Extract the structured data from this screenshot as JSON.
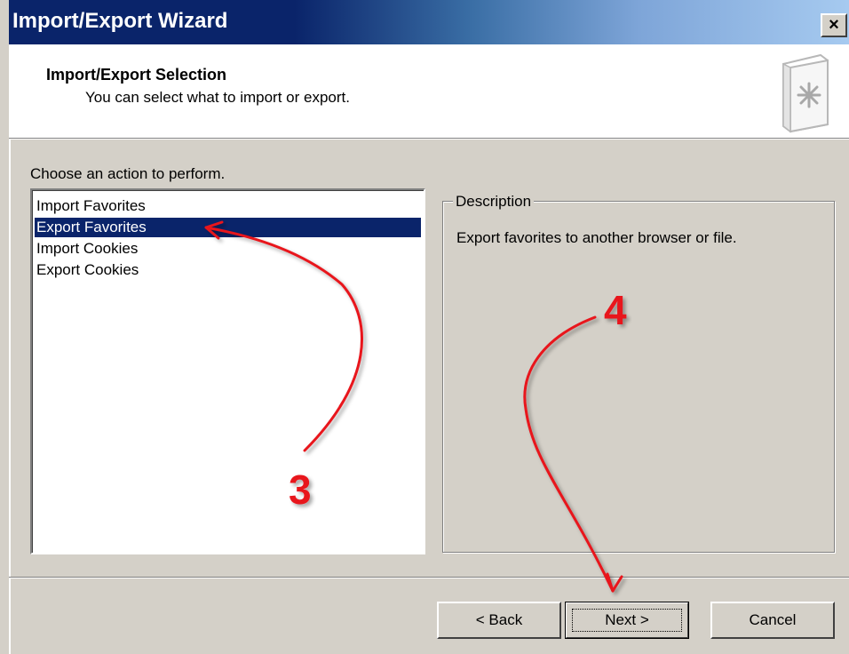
{
  "window": {
    "title": "Import/Export Wizard",
    "close_glyph": "×",
    "close_icon": "close-icon"
  },
  "header": {
    "title": "Import/Export Selection",
    "subtitle": "You can select what to import or export.",
    "icon": "wizard-book-icon"
  },
  "main": {
    "choose_label": "Choose an action to perform.",
    "actions": [
      {
        "label": "Import Favorites",
        "selected": false
      },
      {
        "label": "Export Favorites",
        "selected": true
      },
      {
        "label": "Import Cookies",
        "selected": false
      },
      {
        "label": "Export Cookies",
        "selected": false
      }
    ],
    "description_legend": "Description",
    "description_text": "Export favorites to another browser or file."
  },
  "buttons": {
    "back": "< Back",
    "next": "Next >",
    "cancel": "Cancel"
  },
  "annotations": {
    "step3": "3",
    "step4": "4",
    "color": "#e8121a"
  },
  "colors": {
    "title_active": "#0a246a",
    "face": "#d4d0c8",
    "selection": "#0a246a"
  }
}
